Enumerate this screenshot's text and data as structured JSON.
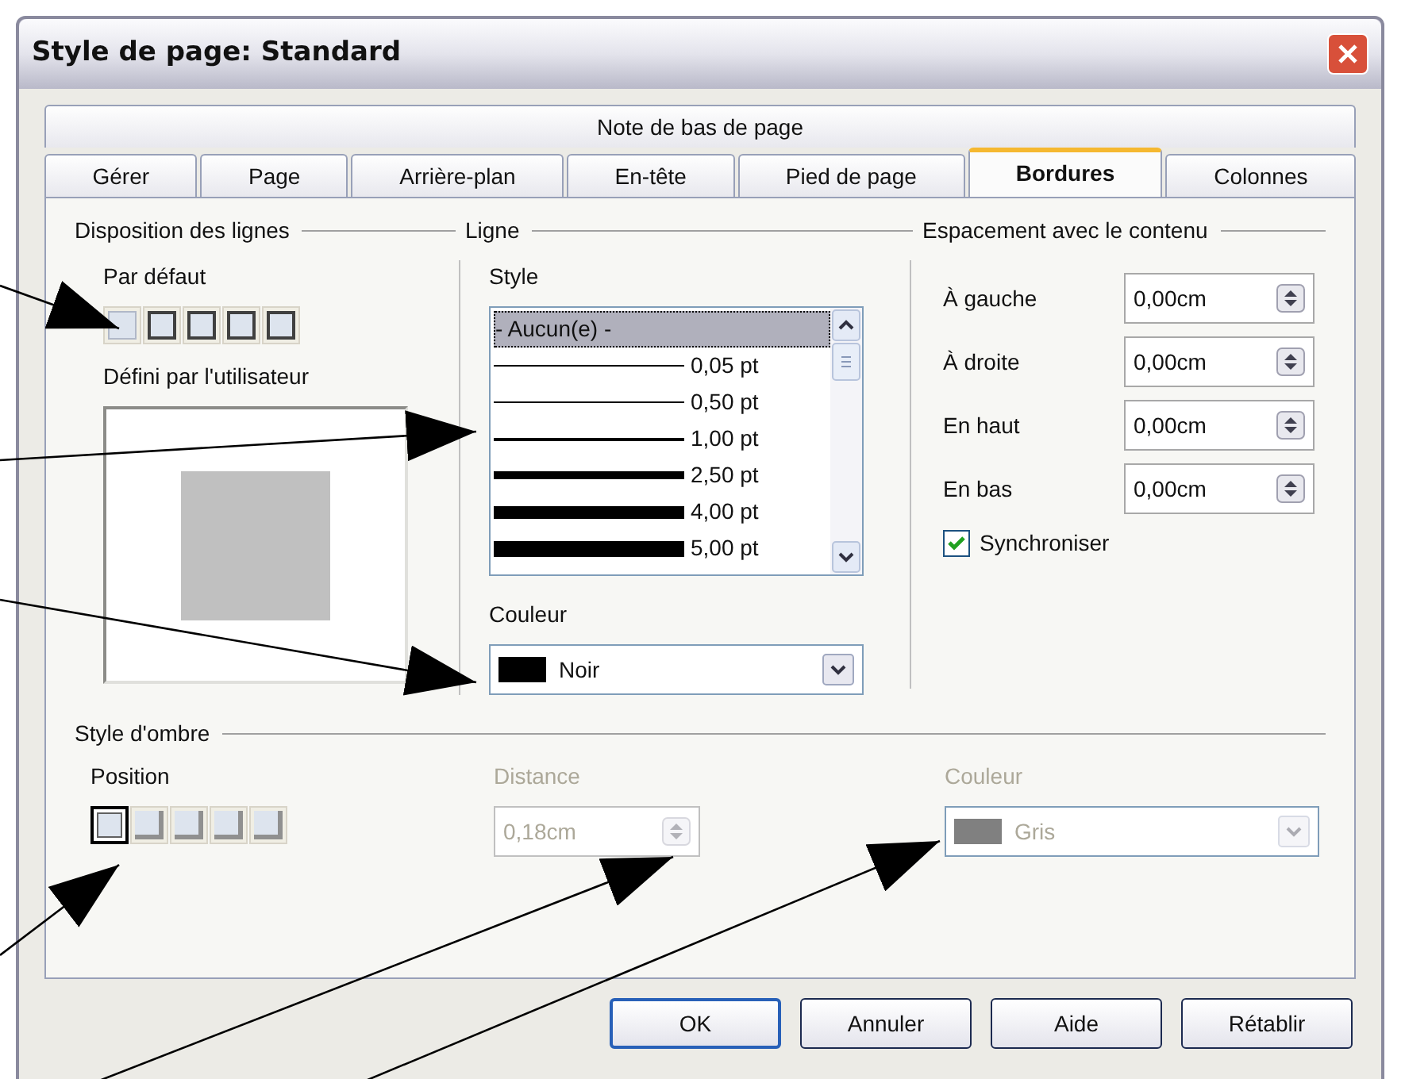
{
  "window": {
    "title": "Style de page: Standard"
  },
  "tab_rows": [
    [
      {
        "label": "Note de bas de page",
        "selected": false
      }
    ],
    [
      {
        "label": "Gérer",
        "selected": false
      },
      {
        "label": "Page",
        "selected": false
      },
      {
        "label": "Arrière-plan",
        "selected": false
      },
      {
        "label": "En-tête",
        "selected": false
      },
      {
        "label": "Pied de page",
        "selected": false
      },
      {
        "label": "Bordures",
        "selected": true
      },
      {
        "label": "Colonnes",
        "selected": false
      }
    ]
  ],
  "line_arrangement": {
    "title": "Disposition des lignes",
    "default_label": "Par défaut",
    "presets": [
      {
        "selected": false
      },
      {
        "selected": false
      },
      {
        "selected": false
      },
      {
        "selected": false
      },
      {
        "selected": false
      }
    ],
    "user_defined_label": "Défini par l'utilisateur"
  },
  "line": {
    "title": "Ligne",
    "style_label": "Style",
    "styles": [
      {
        "kind": "none",
        "label": "- Aucun(e) -",
        "selected": true
      },
      {
        "kind": "line",
        "label": "0,05 pt",
        "selected": false
      },
      {
        "kind": "line",
        "label": "0,50 pt",
        "selected": false
      },
      {
        "kind": "line",
        "label": "1,00 pt",
        "selected": false
      },
      {
        "kind": "line",
        "label": "2,50 pt",
        "selected": false
      },
      {
        "kind": "line",
        "label": "4,00 pt",
        "selected": false
      },
      {
        "kind": "line",
        "label": "5,00 pt",
        "selected": false
      }
    ],
    "color_label": "Couleur",
    "color": {
      "value": "Noir",
      "color": "#000000"
    }
  },
  "spacing": {
    "title": "Espacement avec le contenu",
    "fields": [
      {
        "label": "À gauche",
        "value": "0,00cm"
      },
      {
        "label": "À droite",
        "value": "0,00cm"
      },
      {
        "label": "En haut",
        "value": "0,00cm"
      },
      {
        "label": "En bas",
        "value": "0,00cm"
      }
    ],
    "synchronize": {
      "label": "Synchroniser",
      "checked": true
    }
  },
  "shadow": {
    "title": "Style d'ombre",
    "position_label": "Position",
    "positions": [
      {
        "selected": true
      },
      {
        "selected": false
      },
      {
        "selected": false
      },
      {
        "selected": false
      },
      {
        "selected": false
      }
    ],
    "distance": {
      "label": "Distance",
      "value": "0,18cm",
      "disabled": true
    },
    "color": {
      "label": "Couleur",
      "value": "Gris",
      "color": "#808080",
      "disabled": true
    }
  },
  "buttons": [
    {
      "label": "OK",
      "default": true
    },
    {
      "label": "Annuler",
      "default": false
    },
    {
      "label": "Aide",
      "default": false
    },
    {
      "label": "Rétablir",
      "default": false
    }
  ]
}
